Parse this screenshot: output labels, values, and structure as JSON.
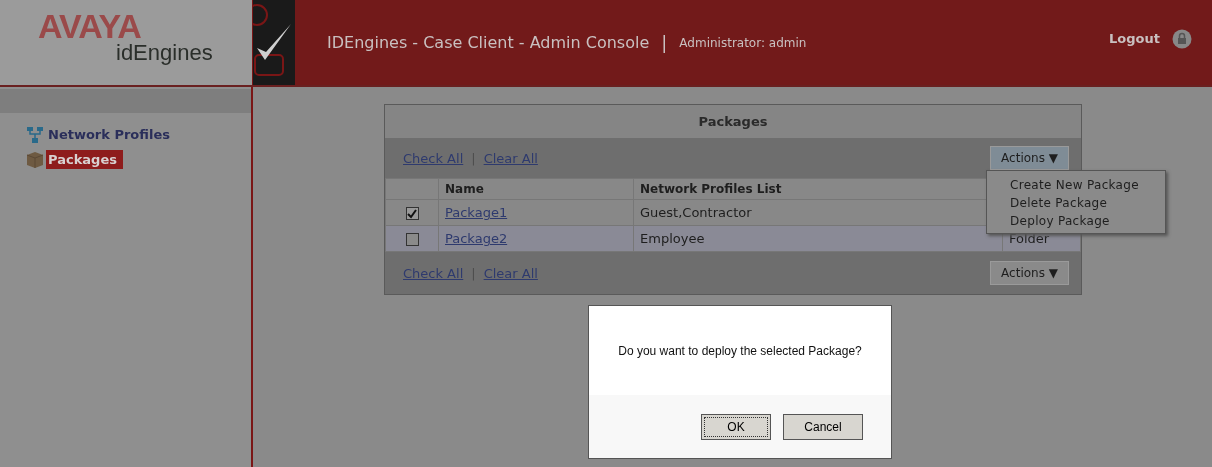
{
  "header": {
    "logo_top": "AVAYA",
    "logo_bottom": "idEngines",
    "title": "IDEngines - Case Client - Admin Console",
    "separator": "|",
    "user": "Administrator: admin",
    "logout": "Logout"
  },
  "sidebar": {
    "items": [
      {
        "label": "Network Profiles",
        "selected": false,
        "kind": "network"
      },
      {
        "label": "Packages",
        "selected": true,
        "kind": "box"
      }
    ]
  },
  "panel": {
    "title": "Packages",
    "check_all": "Check All",
    "divider": "|",
    "clear_all": "Clear All",
    "actions": "Actions",
    "actions_caret": "▼",
    "columns": [
      "Name",
      "Network Profiles List"
    ],
    "rows": [
      {
        "checked": true,
        "name": "Package1",
        "profiles": "Guest,Contractor"
      },
      {
        "checked": false,
        "name": "Package2",
        "profiles": "Employee",
        "column_3": "Folder"
      }
    ],
    "footer": {
      "check_all": "Check All",
      "divider": "|",
      "clear_all": "Clear All",
      "actions": "Actions",
      "actions_caret": "▼"
    }
  },
  "actions_menu": {
    "items": [
      "Create New Package",
      "Delete Package",
      "Deploy Package"
    ]
  },
  "dialog": {
    "message": "Do you want to deploy the selected Package?",
    "buttons": [
      {
        "label": "OK",
        "focused": true
      },
      {
        "label": "Cancel",
        "focused": false
      }
    ]
  }
}
